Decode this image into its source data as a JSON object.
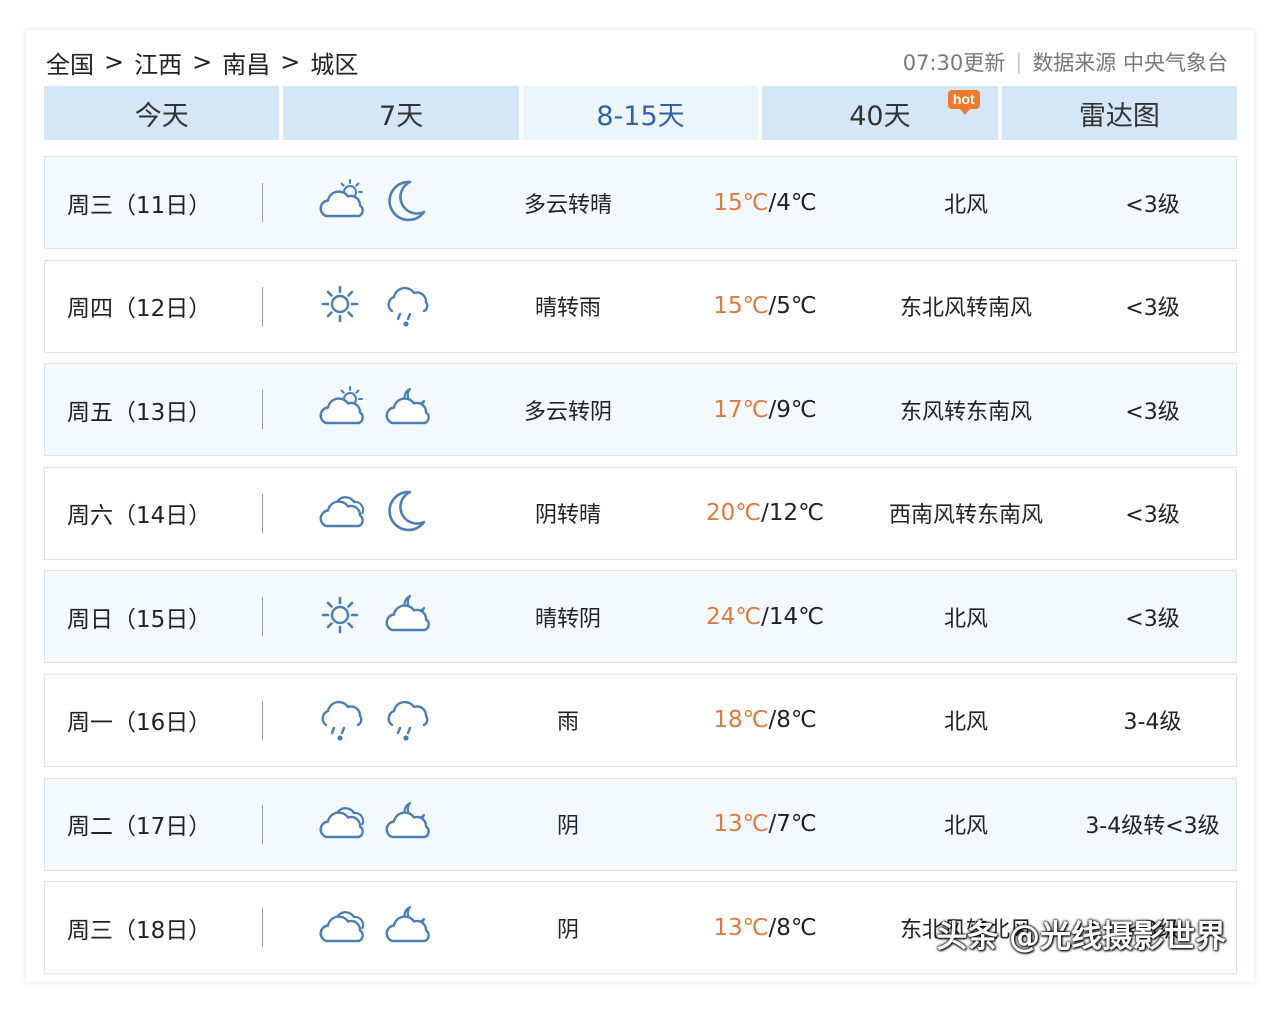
{
  "breadcrumb": [
    "全国",
    "江西",
    "南昌",
    "城区"
  ],
  "breadcrumb_separator": ">",
  "update_time": "07:30更新",
  "meta_divider": "|",
  "data_source": "数据来源 中央气象台",
  "tabs": [
    {
      "label": "今天"
    },
    {
      "label": "7天"
    },
    {
      "label": "8-15天"
    },
    {
      "label": "40天",
      "badge": "hot"
    },
    {
      "label": "雷达图"
    }
  ],
  "active_tab": "8-15天",
  "days": [
    {
      "date": "周三（11日）",
      "day_icon": "partly-cloudy-icon",
      "night_icon": "moon-icon",
      "desc": "多云转晴",
      "high": "15℃",
      "low": "4℃",
      "wind": "北风",
      "level": "<3级"
    },
    {
      "date": "周四（12日）",
      "day_icon": "sun-icon",
      "night_icon": "rain-icon",
      "desc": "晴转雨",
      "high": "15℃",
      "low": "5℃",
      "wind": "东北风转南风",
      "level": "<3级"
    },
    {
      "date": "周五（13日）",
      "day_icon": "partly-cloudy-icon",
      "night_icon": "cloudy-night-icon",
      "desc": "多云转阴",
      "high": "17℃",
      "low": "9℃",
      "wind": "东风转东南风",
      "level": "<3级"
    },
    {
      "date": "周六（14日）",
      "day_icon": "overcast-icon",
      "night_icon": "moon-icon",
      "desc": "阴转晴",
      "high": "20℃",
      "low": "12℃",
      "wind": "西南风转东南风",
      "level": "<3级"
    },
    {
      "date": "周日（15日）",
      "day_icon": "sun-icon",
      "night_icon": "cloudy-night-icon",
      "desc": "晴转阴",
      "high": "24℃",
      "low": "14℃",
      "wind": "北风",
      "level": "<3级"
    },
    {
      "date": "周一（16日）",
      "day_icon": "rain-icon",
      "night_icon": "rain-icon",
      "desc": "雨",
      "high": "18℃",
      "low": "8℃",
      "wind": "北风",
      "level": "3-4级"
    },
    {
      "date": "周二（17日）",
      "day_icon": "overcast-icon",
      "night_icon": "cloudy-night-icon",
      "desc": "阴",
      "high": "13℃",
      "low": "7℃",
      "wind": "北风",
      "level": "3-4级转<3级"
    },
    {
      "date": "周三（18日）",
      "day_icon": "overcast-icon",
      "night_icon": "cloudy-night-icon",
      "desc": "阴",
      "high": "13℃",
      "low": "8℃",
      "wind": "东北风转北风",
      "level": "<3级"
    }
  ],
  "temp_separator": "/",
  "watermark": "头条 @光线摄影世界",
  "colors": {
    "tab_bg": "#d3e7f8",
    "tab_active_bg": "#eef6fd",
    "tab_active_text": "#2f63a8",
    "temp_high": "#e07a3c",
    "hot_badge": "#f07a2b",
    "icon_stroke": "#4a7fb5"
  }
}
